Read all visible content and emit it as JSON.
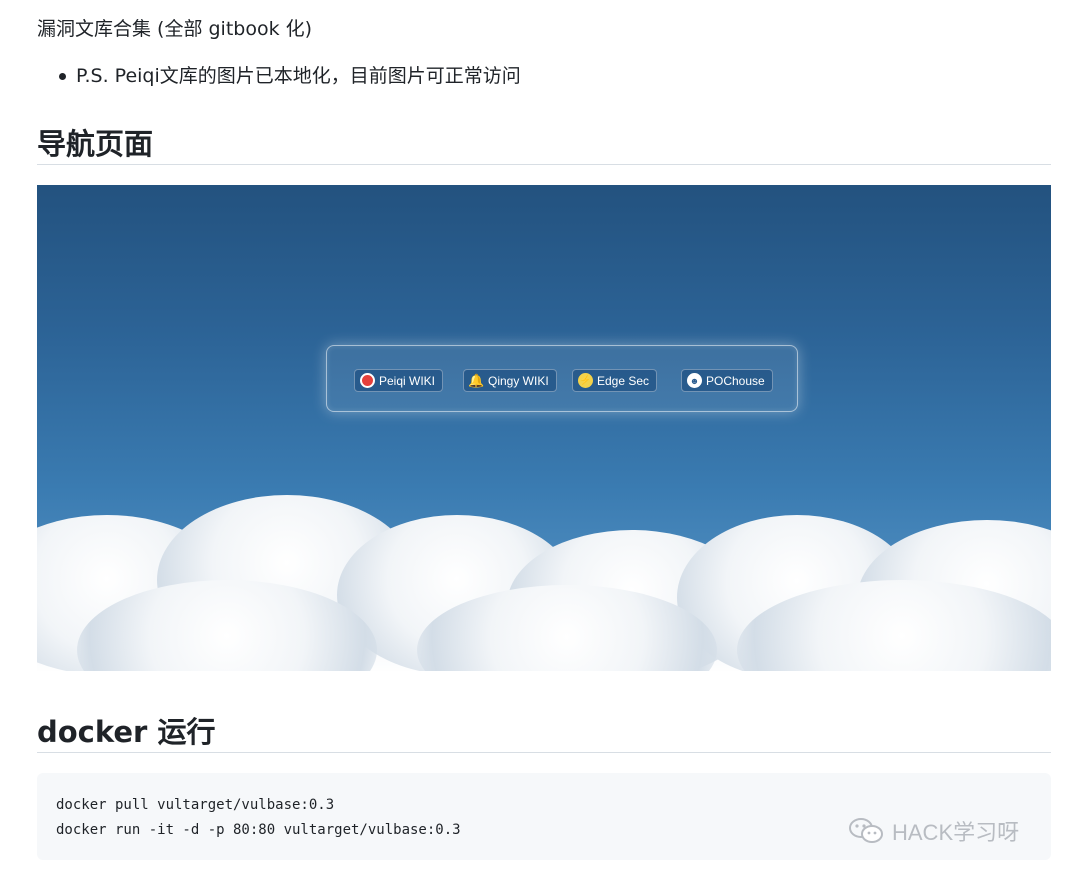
{
  "intro_text": "漏洞文库合集 (全部 gitbook 化)",
  "bullets": [
    "P.S. Peiqi文库的图片已本地化，目前图片可正常访问"
  ],
  "headings": {
    "nav": "导航页面",
    "docker": "docker 运行"
  },
  "nav_screenshot": {
    "buttons": [
      {
        "label": "Peiqi WIKI",
        "icon": "doraemon-icon"
      },
      {
        "label": "Qingy WIKI",
        "icon": "bell-icon"
      },
      {
        "label": "Edge Sec",
        "icon": "pikachu-icon"
      },
      {
        "label": "POChouse",
        "icon": "robot-icon"
      }
    ]
  },
  "code_lines": [
    "docker pull vultarget/vulbase:0.3",
    "docker run -it -d -p 80:80 vultarget/vulbase:0.3"
  ],
  "watermark": "HACK学习呀"
}
